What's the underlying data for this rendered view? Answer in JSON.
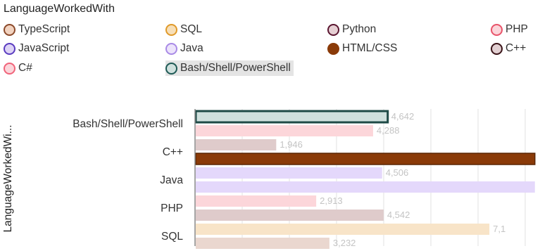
{
  "legend": {
    "title": "LanguageWorkedWith",
    "items": [
      {
        "label": "TypeScript",
        "color": "#8c4a2a",
        "fill": "#f2d3c0",
        "filled": false
      },
      {
        "label": "SQL",
        "color": "#e09a2a",
        "fill": "#f7dfb8",
        "filled": false
      },
      {
        "label": "Python",
        "color": "#5a1630",
        "fill": "#e6cfd3",
        "filled": false
      },
      {
        "label": "PHP",
        "color": "#e8546a",
        "fill": "#fbd5da",
        "filled": false
      },
      {
        "label": "JavaScript",
        "color": "#5a3cc0",
        "fill": "#ddd3f5",
        "filled": false
      },
      {
        "label": "Java",
        "color": "#a98ae6",
        "fill": "#ece3fb",
        "filled": false
      },
      {
        "label": "HTML/CSS",
        "color": "#8a3a08",
        "fill": "#8a3a08",
        "filled": true
      },
      {
        "label": "C++",
        "color": "#3a1418",
        "fill": "#e2d0d2",
        "filled": false
      },
      {
        "label": "C#",
        "color": "#f0647a",
        "fill": "#fbd5da",
        "filled": false
      },
      {
        "label": "Bash/Shell/PowerShell",
        "color": "#1e5a55",
        "fill": "#cfe0dd",
        "filled": false,
        "active": true
      }
    ]
  },
  "chart_data": {
    "type": "bar",
    "orientation": "horizontal",
    "ylabel": "LanguageWorkedWi...",
    "categories": [
      "Bash/Shell/PowerShell",
      "C++",
      "Java",
      "PHP",
      "SQL"
    ],
    "bars": [
      {
        "category": "Bash/Shell/PowerShell",
        "value": 4642,
        "label": "4,642",
        "fill": "#cfe0dd",
        "stroke": "#1e4a46",
        "highlight": true
      },
      {
        "category": "Bash/Shell/PowerShell",
        "value": 4288,
        "label": "4,288",
        "fill": "#fcd6da"
      },
      {
        "category": "C++",
        "value": 1946,
        "label": "1,946",
        "fill": "#dfcbcb"
      },
      {
        "category": "C++",
        "value": 8200,
        "label": "",
        "fill": "#8a3a08",
        "stroke": "#5a2504"
      },
      {
        "category": "Java",
        "value": 4506,
        "label": "4,506",
        "fill": "#e4d8fb"
      },
      {
        "category": "Java",
        "value": 8200,
        "label": "",
        "fill": "#e4d8fb"
      },
      {
        "category": "PHP",
        "value": 2913,
        "label": "2,913",
        "fill": "#fcd6da"
      },
      {
        "category": "PHP",
        "value": 4542,
        "label": "4,542",
        "fill": "#dfcbcb"
      },
      {
        "category": "SQL",
        "value": 7100,
        "label": "7,1",
        "fill": "#f8e4c8"
      },
      {
        "category": "SQL",
        "value": 3232,
        "label": "3,232",
        "fill": "#ead7cf"
      }
    ],
    "xlim": [
      0,
      8000
    ],
    "grid": true
  }
}
